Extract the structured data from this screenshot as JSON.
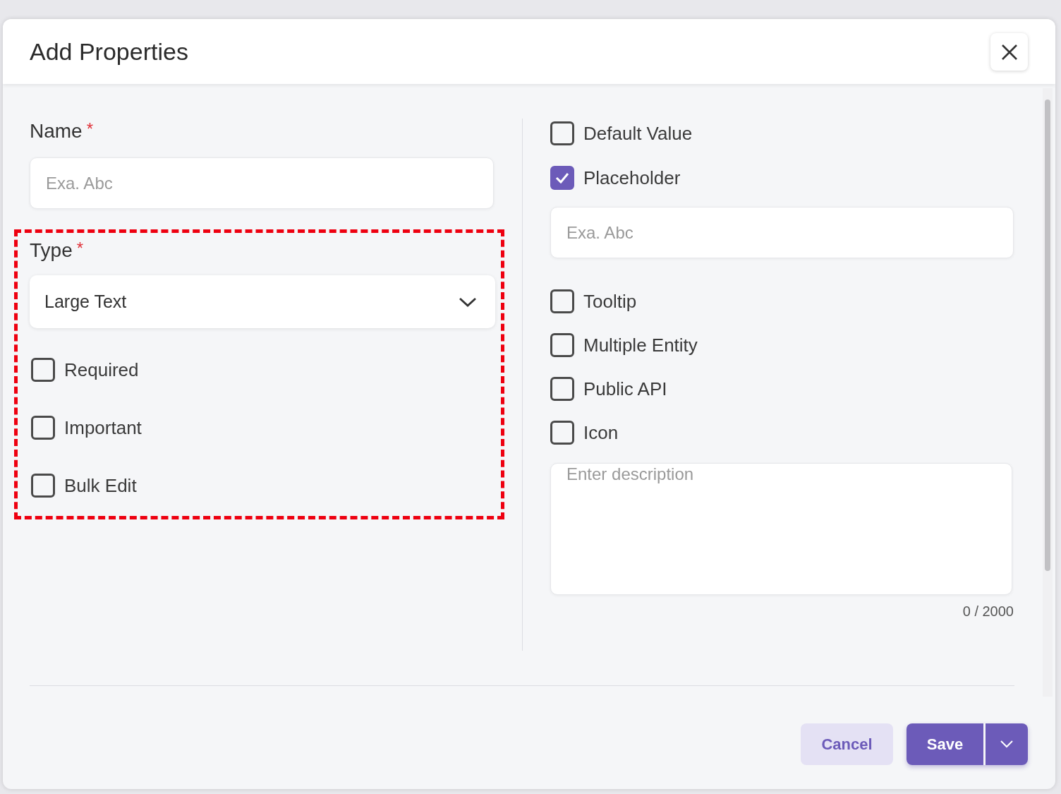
{
  "dialog": {
    "title": "Add Properties"
  },
  "left": {
    "name_field": {
      "label": "Name",
      "required_mark": "*",
      "placeholder": "Exa. Abc"
    },
    "type_field": {
      "label": "Type",
      "required_mark": "*",
      "value": "Large Text"
    },
    "options": [
      {
        "label": "Required",
        "checked": false
      },
      {
        "label": "Important",
        "checked": false
      },
      {
        "label": "Bulk Edit",
        "checked": false
      }
    ]
  },
  "right": {
    "options_top": [
      {
        "label": "Default Value",
        "checked": false
      },
      {
        "label": "Placeholder",
        "checked": true
      }
    ],
    "placeholder_field": {
      "placeholder": "Exa. Abc"
    },
    "options_bottom": [
      {
        "label": "Tooltip",
        "checked": false
      },
      {
        "label": "Multiple Entity",
        "checked": false
      },
      {
        "label": "Public API",
        "checked": false
      },
      {
        "label": "Icon",
        "checked": false
      }
    ],
    "description": {
      "placeholder": "Enter description"
    },
    "counter": "0 / 2000"
  },
  "buttons": [
    {
      "label": "Cancel",
      "kind": "secondary"
    },
    {
      "label": "Save",
      "kind": "primary"
    }
  ]
}
